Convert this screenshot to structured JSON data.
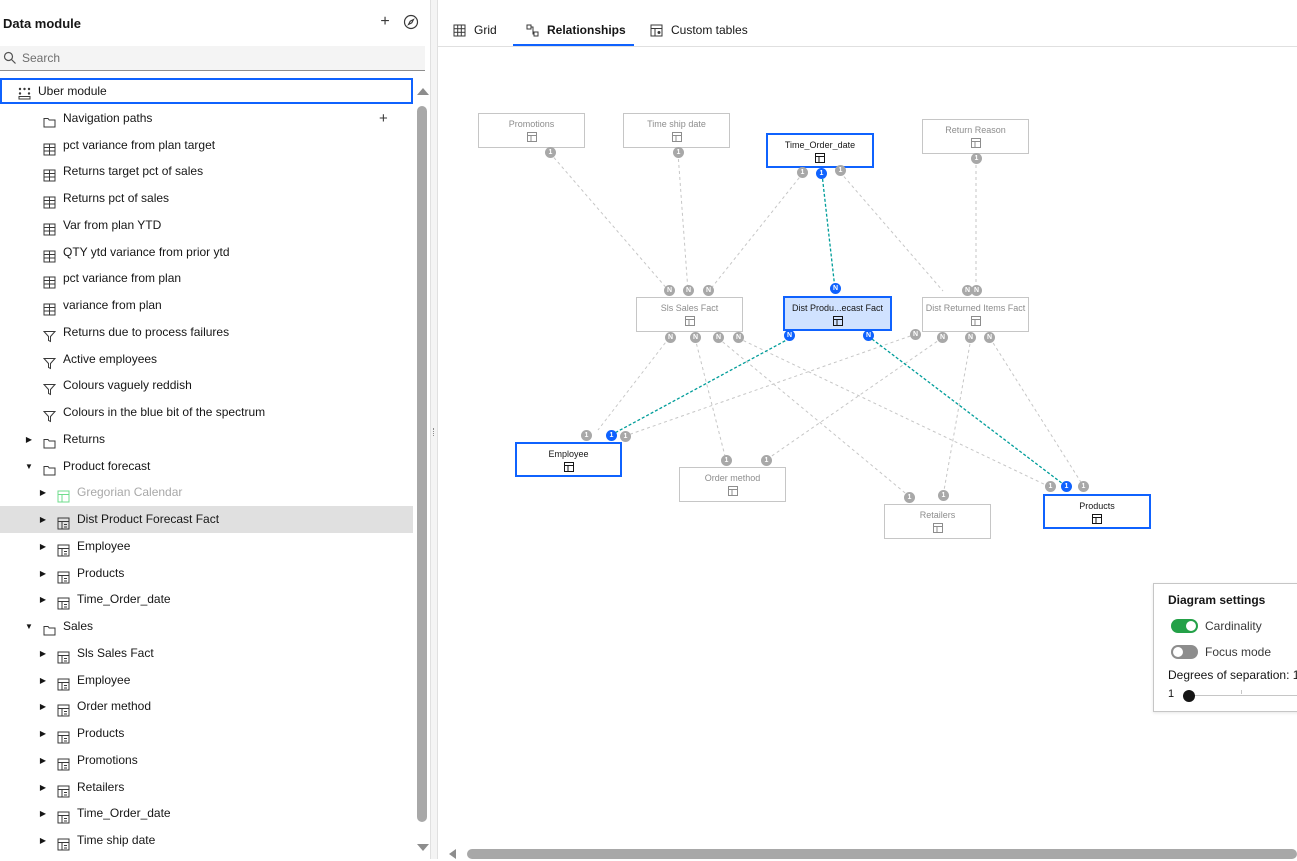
{
  "panel": {
    "title": "Data module",
    "search_placeholder": "Search"
  },
  "tree": [
    {
      "label": "Uber module",
      "icon": "module-icon",
      "level": 0,
      "expand": "none",
      "root": true
    },
    {
      "label": "Navigation paths",
      "icon": "folder-icon",
      "level": 1,
      "expand": "none",
      "plus": "+"
    },
    {
      "label": "pct variance from plan target",
      "icon": "calculation-icon",
      "level": 1,
      "expand": "none"
    },
    {
      "label": "Returns target pct of sales",
      "icon": "calculation-icon",
      "level": 1,
      "expand": "none"
    },
    {
      "label": "Returns pct of sales",
      "icon": "calculation-icon",
      "level": 1,
      "expand": "none"
    },
    {
      "label": "Var from plan YTD",
      "icon": "calculation-icon",
      "level": 1,
      "expand": "none"
    },
    {
      "label": "QTY ytd variance from prior ytd",
      "icon": "calculation-icon",
      "level": 1,
      "expand": "none"
    },
    {
      "label": "pct variance from plan",
      "icon": "calculation-icon",
      "level": 1,
      "expand": "none"
    },
    {
      "label": "variance from plan",
      "icon": "calculation-icon",
      "level": 1,
      "expand": "none"
    },
    {
      "label": "Returns due to process failures",
      "icon": "filter-icon",
      "level": 1,
      "expand": "none"
    },
    {
      "label": "Active employees",
      "icon": "filter-icon",
      "level": 1,
      "expand": "none"
    },
    {
      "label": "Colours vaguely reddish",
      "icon": "filter-icon",
      "level": 1,
      "expand": "none"
    },
    {
      "label": "Colours in the blue bit of the spectrum",
      "icon": "filter-icon",
      "level": 1,
      "expand": "none"
    },
    {
      "label": "Returns",
      "icon": "folder-icon",
      "level": 1,
      "expand": "collapsed"
    },
    {
      "label": "Product forecast",
      "icon": "folder-icon",
      "level": 1,
      "expand": "expanded"
    },
    {
      "label": "Gregorian Calendar",
      "icon": "table-icon",
      "level": 2,
      "expand": "collapsed",
      "disabled": true
    },
    {
      "label": "Dist Product Forecast Fact",
      "icon": "table-icon",
      "level": 2,
      "expand": "collapsed",
      "selected": true
    },
    {
      "label": "Employee",
      "icon": "table-icon",
      "level": 2,
      "expand": "collapsed"
    },
    {
      "label": "Products",
      "icon": "table-icon",
      "level": 2,
      "expand": "collapsed"
    },
    {
      "label": "Time_Order_date",
      "icon": "table-icon",
      "level": 2,
      "expand": "collapsed"
    },
    {
      "label": "Sales",
      "icon": "folder-icon",
      "level": 1,
      "expand": "expanded"
    },
    {
      "label": "Sls Sales Fact",
      "icon": "table-icon",
      "level": 2,
      "expand": "collapsed"
    },
    {
      "label": "Employee",
      "icon": "table-icon",
      "level": 2,
      "expand": "collapsed"
    },
    {
      "label": "Order method",
      "icon": "table-icon",
      "level": 2,
      "expand": "collapsed"
    },
    {
      "label": "Products",
      "icon": "table-icon",
      "level": 2,
      "expand": "collapsed"
    },
    {
      "label": "Promotions",
      "icon": "table-icon",
      "level": 2,
      "expand": "collapsed"
    },
    {
      "label": "Retailers",
      "icon": "table-icon",
      "level": 2,
      "expand": "collapsed"
    },
    {
      "label": "Time_Order_date",
      "icon": "table-icon",
      "level": 2,
      "expand": "collapsed"
    },
    {
      "label": "Time ship date",
      "icon": "table-icon",
      "level": 2,
      "expand": "collapsed"
    }
  ],
  "tabs": [
    {
      "label": "Grid",
      "icon": "grid-icon",
      "active": false
    },
    {
      "label": "Relationships",
      "icon": "relationships-icon",
      "active": true
    },
    {
      "label": "Custom tables",
      "icon": "custom-tables-icon",
      "active": false
    }
  ],
  "diagram": {
    "nodes": [
      {
        "id": "promotions",
        "label": "Promotions",
        "state": "normal"
      },
      {
        "id": "timeship",
        "label": "Time ship date",
        "state": "normal"
      },
      {
        "id": "timeorder",
        "label": "Time_Order_date",
        "state": "highlighted"
      },
      {
        "id": "returnreason",
        "label": "Return Reason",
        "state": "normal"
      },
      {
        "id": "slssales",
        "label": "Sls Sales Fact",
        "state": "normal"
      },
      {
        "id": "distprod",
        "label": "Dist Produ...ecast Fact",
        "state": "selected"
      },
      {
        "id": "distreturned",
        "label": "Dist Returned Items Fact",
        "state": "normal"
      },
      {
        "id": "employee",
        "label": "Employee",
        "state": "highlighted"
      },
      {
        "id": "ordermethod",
        "label": "Order method",
        "state": "normal"
      },
      {
        "id": "retailers",
        "label": "Retailers",
        "state": "normal"
      },
      {
        "id": "products",
        "label": "Products",
        "state": "highlighted"
      }
    ],
    "badges": [
      {
        "text": "1",
        "color": "gray"
      },
      {
        "text": "1",
        "color": "gray"
      },
      {
        "text": "1",
        "color": "gray"
      },
      {
        "text": "1",
        "color": "blue"
      },
      {
        "text": "1",
        "color": "gray"
      },
      {
        "text": "1",
        "color": "gray"
      },
      {
        "text": "N",
        "color": "gray"
      },
      {
        "text": "N",
        "color": "gray"
      },
      {
        "text": "N",
        "color": "gray"
      },
      {
        "text": "N",
        "color": "blue"
      },
      {
        "text": "N",
        "color": "gray"
      },
      {
        "text": "N",
        "color": "gray"
      },
      {
        "text": "N",
        "color": "gray"
      },
      {
        "text": "N",
        "color": "gray"
      },
      {
        "text": "N",
        "color": "gray"
      },
      {
        "text": "N",
        "color": "gray"
      },
      {
        "text": "N",
        "color": "blue"
      },
      {
        "text": "N",
        "color": "blue"
      },
      {
        "text": "N",
        "color": "gray"
      },
      {
        "text": "N",
        "color": "gray"
      },
      {
        "text": "N",
        "color": "gray"
      },
      {
        "text": "N",
        "color": "gray"
      },
      {
        "text": "1",
        "color": "gray"
      },
      {
        "text": "1",
        "color": "blue"
      },
      {
        "text": "1",
        "color": "gray"
      },
      {
        "text": "1",
        "color": "gray"
      },
      {
        "text": "1",
        "color": "gray"
      },
      {
        "text": "1",
        "color": "gray"
      },
      {
        "text": "1",
        "color": "gray"
      },
      {
        "text": "1",
        "color": "gray"
      },
      {
        "text": "1",
        "color": "blue"
      },
      {
        "text": "1",
        "color": "gray"
      }
    ]
  },
  "settings": {
    "title": "Diagram settings",
    "cardinality_label": "Cardinality",
    "cardinality_on": true,
    "focus_label": "Focus mode",
    "focus_on": false,
    "degrees_label": "Degrees of separation: 1",
    "slider_min": "1",
    "slider_value": 1
  },
  "colors": {
    "accent": "#0f62fe",
    "toggle_on": "#24a148",
    "highlight_link": "#009d9a",
    "link": "#c6c6c6",
    "selected_node_bg": "#d0e2ff"
  }
}
